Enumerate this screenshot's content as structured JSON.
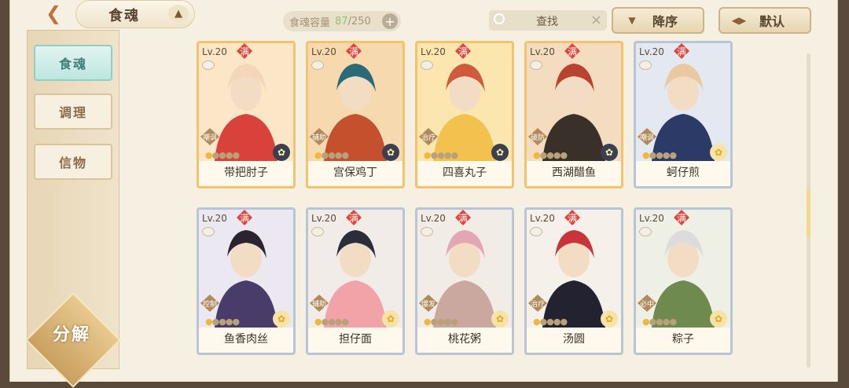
{
  "header": {
    "title": "食魂",
    "capacity_label": "食魂容量",
    "capacity_current": "87",
    "capacity_total": "/250",
    "capacity_add": "+",
    "search_label": "查找",
    "search_clear": "×",
    "sort_label": "降序",
    "default_label": "默认"
  },
  "sidebar": {
    "tabs": [
      {
        "label": "食魂",
        "active": true
      },
      {
        "label": "调理",
        "active": false
      },
      {
        "label": "信物",
        "active": false
      }
    ],
    "decompose_label": "分解"
  },
  "cards": [
    {
      "name": "带把肘子",
      "level": "Lv.20",
      "full": "满",
      "role": "嘲讽",
      "frame": "gold",
      "flower": "dark",
      "stars_on": 1,
      "art_colors": [
        "#fbe7c8",
        "#d8423a",
        "#f4d7b8"
      ]
    },
    {
      "name": "宫保鸡丁",
      "level": "Lv.20",
      "full": "满",
      "role": "辅助",
      "frame": "gold",
      "flower": "dark",
      "stars_on": 1,
      "art_colors": [
        "#f7d9b0",
        "#c4502e",
        "#2b6b78"
      ]
    },
    {
      "name": "四喜丸子",
      "level": "Lv.20",
      "full": "满",
      "role": "治疗",
      "frame": "gold",
      "flower": "dark",
      "stars_on": 1,
      "art_colors": [
        "#fbe6b0",
        "#f2c14e",
        "#cf5a3c"
      ]
    },
    {
      "name": "西湖醋鱼",
      "level": "Lv.20",
      "full": "满",
      "role": "破防",
      "frame": "gold",
      "flower": "dark",
      "stars_on": 1,
      "art_colors": [
        "#f3dcc0",
        "#3a302a",
        "#b8442f"
      ]
    },
    {
      "name": "蚵仔煎",
      "level": "Lv.20",
      "full": "满",
      "role": "嘲讽",
      "frame": "blue",
      "flower": "gold",
      "stars_on": 1,
      "art_colors": [
        "#e4e8f0",
        "#2b3a66",
        "#e8c9a0"
      ]
    },
    {
      "name": "鱼香肉丝",
      "level": "Lv.20",
      "full": "满",
      "role": "控制",
      "frame": "blue",
      "flower": "gold",
      "stars_on": 1,
      "art_colors": [
        "#ece8f2",
        "#4a3c6a",
        "#2a2430"
      ]
    },
    {
      "name": "担仔面",
      "level": "Lv.20",
      "full": "满",
      "role": "辅助",
      "frame": "blue",
      "flower": "gold",
      "stars_on": 1,
      "art_colors": [
        "#f1ece8",
        "#f2a3a8",
        "#2a2e3a"
      ]
    },
    {
      "name": "桃花粥",
      "level": "Lv.20",
      "full": "满",
      "role": "爆发",
      "frame": "blue",
      "flower": "gold",
      "stars_on": 1,
      "art_colors": [
        "#f2ece6",
        "#caa8a0",
        "#e3a6b4"
      ]
    },
    {
      "name": "汤圆",
      "level": "Lv.20",
      "full": "满",
      "role": "治疗",
      "frame": "blue",
      "flower": "gold",
      "stars_on": 1,
      "art_colors": [
        "#f6f0ea",
        "#222230",
        "#c8343a"
      ]
    },
    {
      "name": "粽子",
      "level": "Lv.20",
      "full": "满",
      "role": "必中",
      "frame": "blue",
      "flower": "gold",
      "stars_on": 1,
      "art_colors": [
        "#eef0e6",
        "#6f8a4e",
        "#dcdcdc"
      ]
    }
  ]
}
